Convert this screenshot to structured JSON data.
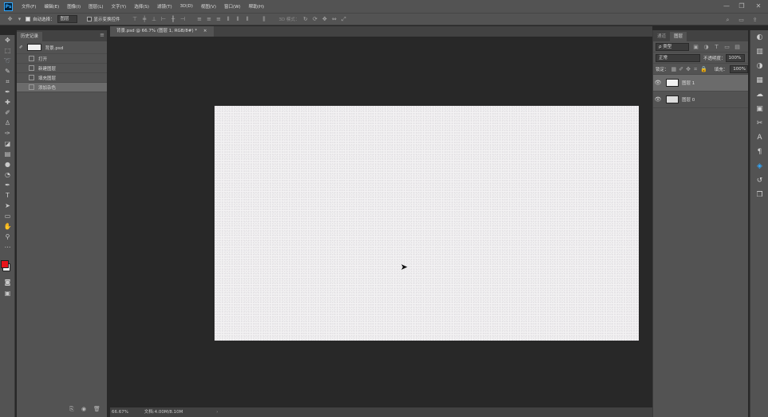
{
  "app": {
    "logo": "Ps"
  },
  "menu": [
    "文件(F)",
    "编辑(E)",
    "图像(I)",
    "图层(L)",
    "文字(Y)",
    "选择(S)",
    "滤镜(T)",
    "3D(D)",
    "视图(V)",
    "窗口(W)",
    "帮助(H)"
  ],
  "window_controls": {
    "minimize": "—",
    "restore": "❐",
    "close": "✕"
  },
  "options": {
    "auto_select_label": "自动选择：",
    "auto_select_value": "图层",
    "show_transform_label": "显示变换控件",
    "mode_3d_label": "3D 模式："
  },
  "history_panel": {
    "tab_label": "历史记录",
    "snapshot_name": "背景.psd",
    "items": [
      {
        "label": "打开"
      },
      {
        "label": "新建图层"
      },
      {
        "label": "填充图层"
      },
      {
        "label": "添加杂色"
      }
    ]
  },
  "document": {
    "tab_title": "背景.psd @ 66.7% (图层 1, RGB/8#) *",
    "tab_close": "×",
    "zoom": "66.67%",
    "doc_info": "文档:4.00M/8.10M"
  },
  "layers_panel": {
    "tabs": [
      "通道",
      "图层"
    ],
    "filter_label": "ρ 类型",
    "blend_mode": "正常",
    "opacity_label": "不透明度：",
    "opacity_value": "100%",
    "lock_label": "锁定：",
    "fill_label": "填充：",
    "fill_value": "100%",
    "layers": [
      {
        "name": "图层 1",
        "visible": true
      },
      {
        "name": "图层 0",
        "visible": true
      }
    ]
  },
  "colors": {
    "foreground": "#e8141b",
    "background": "#ffffff",
    "accent": "#31a8ff"
  },
  "icons": {
    "toolbar": [
      "move-icon",
      "marquee-icon",
      "lasso-icon",
      "quick-select-icon",
      "crop-icon",
      "eyedropper-icon",
      "healing-brush-icon",
      "brush-icon",
      "clone-stamp-icon",
      "history-brush-icon",
      "eraser-icon",
      "gradient-icon",
      "blur-icon",
      "dodge-icon",
      "pen-icon",
      "type-icon",
      "path-select-icon",
      "shape-icon",
      "hand-icon",
      "zoom-icon",
      "more-tools-icon"
    ],
    "right_strip": [
      "adjustments-icon",
      "libraries-icon",
      "color-icon",
      "swatches-icon",
      "styles-icon",
      "properties-icon",
      "brush-settings-icon",
      "character-icon",
      "paragraph-icon",
      "navigator-icon",
      "history-icon",
      "layer-comps-icon"
    ]
  }
}
